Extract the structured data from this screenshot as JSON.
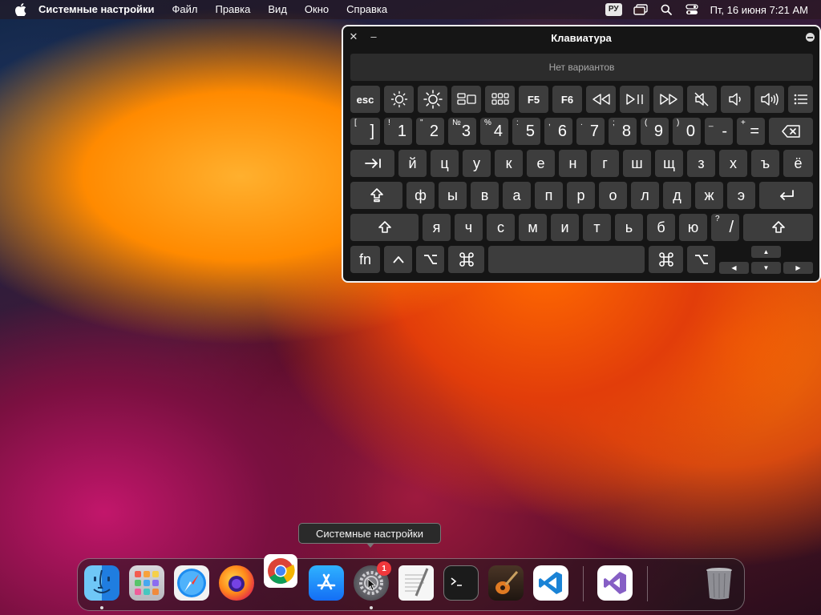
{
  "menubar": {
    "app_name": "Системные настройки",
    "menus": [
      "Файл",
      "Правка",
      "Вид",
      "Окно",
      "Справка"
    ],
    "input_language": "РУ",
    "clock": "Пт, 16 июня  7:21 AM",
    "icons": [
      "apple-icon",
      "window-overview-icon",
      "search-icon",
      "control-center-icon"
    ]
  },
  "keyboard_viewer": {
    "title": "Клавиатура",
    "suggestions_placeholder": "Нет вариантов",
    "fn_row": [
      "esc",
      "brightness-down-icon",
      "brightness-up-icon",
      "mission-control-icon",
      "launchpad-icon",
      "F5",
      "F6",
      "rewind-icon",
      "play-pause-icon",
      "fast-forward-icon",
      "mute-icon",
      "volume-down-icon",
      "volume-up-icon",
      "list-icon"
    ],
    "labels": {
      "esc": "esc",
      "f5": "F5",
      "f6": "F6",
      "fn": "fn"
    },
    "number_row": [
      {
        "sup": "[",
        "main": "]"
      },
      {
        "sup": "!",
        "main": "1"
      },
      {
        "sup": "\"",
        "main": "2"
      },
      {
        "sup": "№",
        "main": "3"
      },
      {
        "sup": "%",
        "main": "4"
      },
      {
        "sup": ":",
        "main": "5"
      },
      {
        "sup": ",",
        "main": "6"
      },
      {
        "sup": ".",
        "main": "7"
      },
      {
        "sup": ";",
        "main": "8"
      },
      {
        "sup": "(",
        "main": "9"
      },
      {
        "sup": ")",
        "main": "0"
      },
      {
        "sup": "_",
        "main": "-"
      },
      {
        "sup": "+",
        "main": "="
      }
    ],
    "row2": [
      "й",
      "ц",
      "у",
      "к",
      "е",
      "н",
      "г",
      "ш",
      "щ",
      "з",
      "х",
      "ъ",
      "ё"
    ],
    "row3": [
      "ф",
      "ы",
      "в",
      "а",
      "п",
      "р",
      "о",
      "л",
      "д",
      "ж",
      "э"
    ],
    "row4": [
      "я",
      "ч",
      "с",
      "м",
      "и",
      "т",
      "ь",
      "б",
      "ю"
    ],
    "row4_last": {
      "sup": "?",
      "main": "/"
    }
  },
  "dock": {
    "tooltip": "Системные настройки",
    "apps": [
      "Finder",
      "Launchpad",
      "Safari",
      "Firefox",
      "Chrome",
      "App Store",
      "System Settings",
      "TextEdit",
      "Terminal",
      "GarageBand",
      "Visual Studio Code",
      "Visual Studio",
      "Trash"
    ],
    "system_settings_badge": "1"
  },
  "colors": {
    "key_bg": "#3d3d3d",
    "window_bg": "#151515",
    "badge_red": "#f0383c"
  }
}
